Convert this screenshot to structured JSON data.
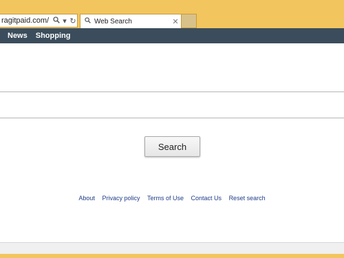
{
  "address_bar": {
    "url": "ragitpaid.com/",
    "search_icon": "magnifier-icon",
    "dropdown_icon": "chevron-down-icon",
    "refresh_icon": "refresh-icon"
  },
  "tab": {
    "title": "Web Search",
    "icon": "search-icon",
    "close": "✕"
  },
  "nav": {
    "items": [
      "News",
      "Shopping"
    ]
  },
  "search": {
    "value": "",
    "button_label": "Search"
  },
  "footer": {
    "links": [
      "About",
      "Privacy policy",
      "Terms of Use",
      "Contact Us",
      "Reset search"
    ]
  },
  "colors": {
    "frame": "#f2c55e",
    "navbar": "#3b4d5c",
    "link": "#1f3c88"
  }
}
